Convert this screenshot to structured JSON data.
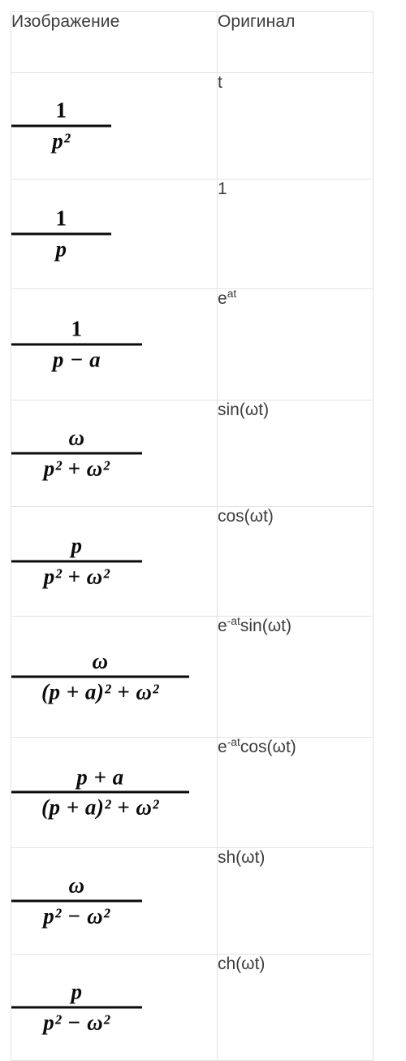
{
  "table": {
    "columns": [
      {
        "key": "image",
        "header": "Изображение"
      },
      {
        "key": "original",
        "header": "Оригинал"
      }
    ],
    "rows": [
      {
        "image": {
          "numerator": "1",
          "denominator": "p²",
          "num_plain": "1",
          "den_plain": "p^2"
        },
        "original": {
          "base": "t",
          "sup": ""
        }
      },
      {
        "image": {
          "numerator": "1",
          "denominator": "p",
          "num_plain": "1",
          "den_plain": "p"
        },
        "original": {
          "base": "1",
          "sup": ""
        }
      },
      {
        "image": {
          "numerator": "1",
          "denominator": "p − a",
          "num_plain": "1",
          "den_plain": "p - a"
        },
        "original": {
          "base": "e",
          "sup": "at"
        }
      },
      {
        "image": {
          "numerator": "ω",
          "denominator": "p² + ω²",
          "num_plain": "omega",
          "den_plain": "p^2 + omega^2"
        },
        "original": {
          "base": "sin(ωt)",
          "sup": ""
        }
      },
      {
        "image": {
          "numerator": "p",
          "denominator": "p² + ω²",
          "num_plain": "p",
          "den_plain": "p^2 + omega^2"
        },
        "original": {
          "base": "cos(ωt)",
          "sup": ""
        }
      },
      {
        "image": {
          "numerator": "ω",
          "denominator": "(p + a)² + ω²",
          "num_plain": "omega",
          "den_plain": "(p + a)^2 + omega^2"
        },
        "original": {
          "base": "e",
          "sup": "-at",
          "tail": "sin(ωt)"
        }
      },
      {
        "image": {
          "numerator": "p + a",
          "denominator": "(p + a)² + ω²",
          "num_plain": "p + a",
          "den_plain": "(p + a)^2 + omega^2"
        },
        "original": {
          "base": "e",
          "sup": "-at",
          "tail": "cos(ωt)"
        }
      },
      {
        "image": {
          "numerator": "ω",
          "denominator": "p² − ω²",
          "num_plain": "omega",
          "den_plain": "p^2 - omega^2"
        },
        "original": {
          "base": "sh(ωt)",
          "sup": ""
        }
      },
      {
        "image": {
          "numerator": "p",
          "denominator": "p² − ω²",
          "num_plain": "p",
          "den_plain": "p^2 - omega^2"
        },
        "original": {
          "base": "ch(ωt)",
          "sup": ""
        }
      }
    ]
  },
  "style": {
    "page_background": "#ffffff",
    "cell_background": "#ffffff",
    "border_color": "#e3e3e3",
    "header_text_color": "#3c3c3c",
    "formula_text_color": "#0b0b0b",
    "original_text_color": "#3c3c3c"
  }
}
